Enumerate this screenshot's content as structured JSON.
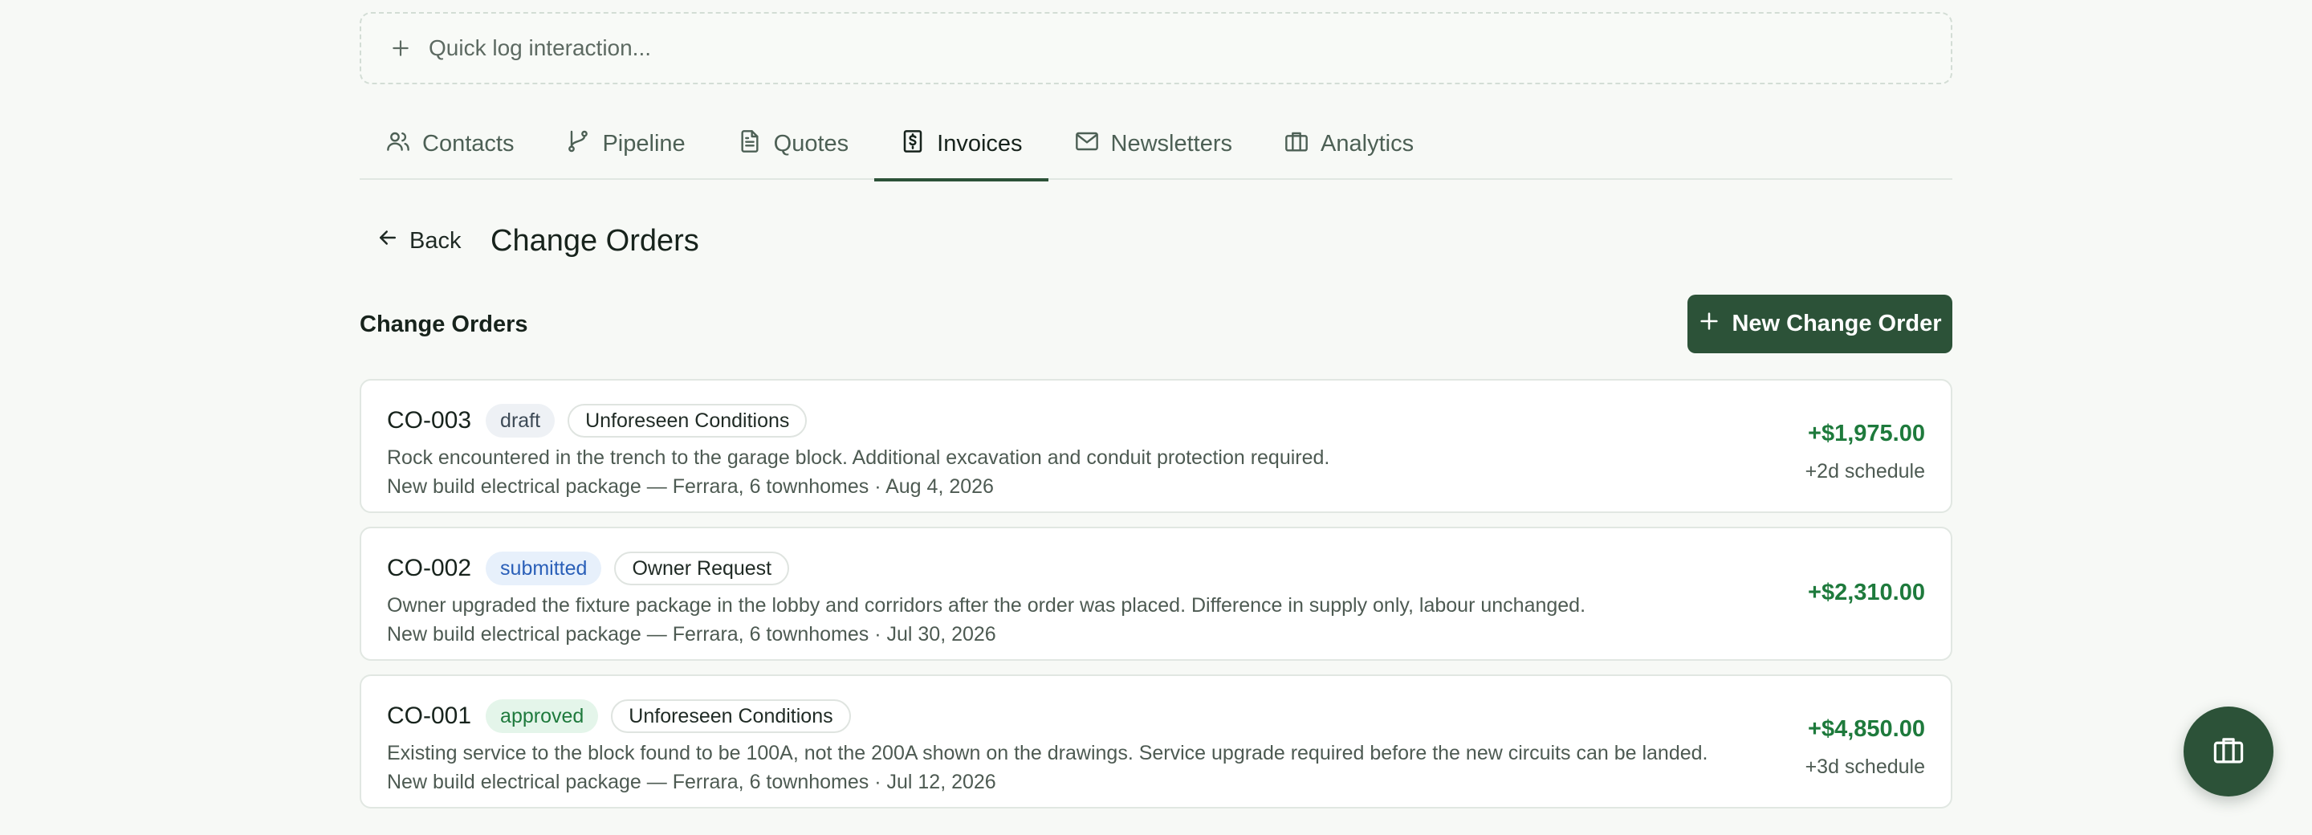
{
  "quick_log": {
    "placeholder": "Quick log interaction..."
  },
  "tabs": [
    {
      "label": "Contacts",
      "icon": "users-icon"
    },
    {
      "label": "Pipeline",
      "icon": "git-branch-icon"
    },
    {
      "label": "Quotes",
      "icon": "file-text-icon"
    },
    {
      "label": "Invoices",
      "icon": "receipt-dollar-icon",
      "active": true
    },
    {
      "label": "Newsletters",
      "icon": "mail-icon"
    },
    {
      "label": "Analytics",
      "icon": "briefcase-icon"
    }
  ],
  "header": {
    "back_label": "Back",
    "title": "Change Orders"
  },
  "section": {
    "title": "Change Orders",
    "new_button_label": "New Change Order"
  },
  "change_orders": [
    {
      "code": "CO-003",
      "status": "draft",
      "category": "Unforeseen Conditions",
      "description": "Rock encountered in the trench to the garage block. Additional excavation and conduit protection required.",
      "meta": "New build electrical package — Ferrara, 6 townhomes · Aug 4, 2026",
      "amount": "+$1,975.00",
      "schedule": "+2d schedule"
    },
    {
      "code": "CO-002",
      "status": "submitted",
      "category": "Owner Request",
      "description": "Owner upgraded the fixture package in the lobby and corridors after the order was placed. Difference in supply only, labour unchanged.",
      "meta": "New build electrical package — Ferrara, 6 townhomes · Jul 30, 2026",
      "amount": "+$2,310.00",
      "schedule": ""
    },
    {
      "code": "CO-001",
      "status": "approved",
      "category": "Unforeseen Conditions",
      "description": "Existing service to the block found to be 100A, not the 200A shown on the drawings. Service upgrade required before the new circuits can be landed.",
      "meta": "New build electrical package — Ferrara, 6 townhomes · Jul 12, 2026",
      "amount": "+$4,850.00",
      "schedule": "+3d schedule"
    }
  ],
  "colors": {
    "brand": "#2c5238",
    "amount_positive": "#1e7a3c",
    "background": "#f7f9f6"
  },
  "fab": {
    "icon": "briefcase-icon"
  }
}
